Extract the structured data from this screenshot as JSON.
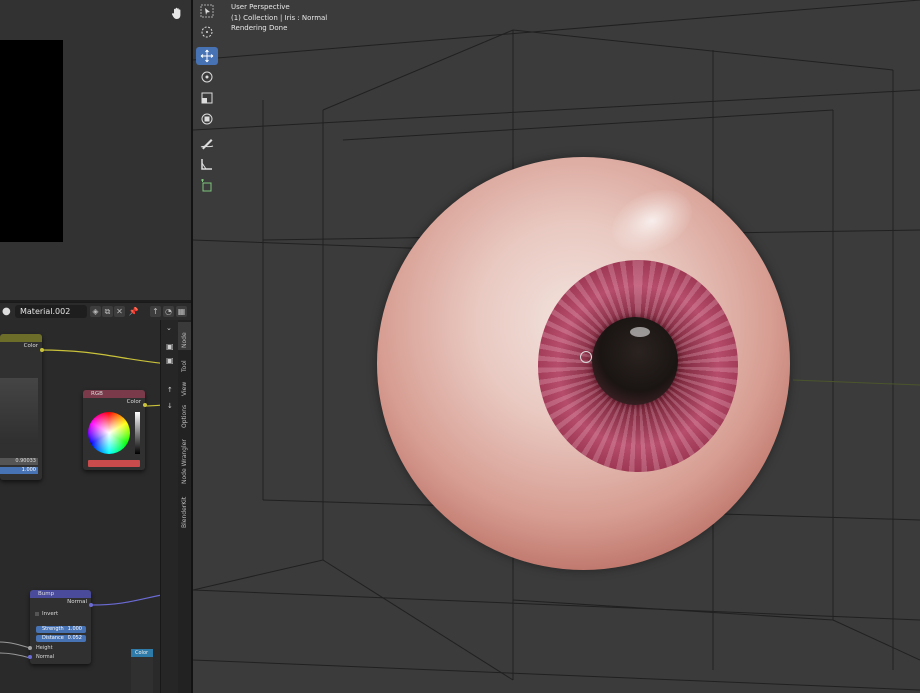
{
  "viewport": {
    "overlay": {
      "perspective": "User Perspective",
      "collection": "(1) Collection | Iris : Normal",
      "status": "Rendering Done"
    },
    "tools": [
      "select-box",
      "cursor",
      "move",
      "rotate",
      "scale",
      "transform",
      "annotate",
      "measure",
      "add-cube"
    ],
    "active_tool": "move"
  },
  "node_editor": {
    "material_name": "Material.002",
    "sidebar_tabs": [
      "Node",
      "Tool",
      "View",
      "Options",
      "Node Wrangler",
      "BlenderKit"
    ],
    "active_tab": "Node",
    "curves_node": {
      "output": "Color",
      "field_value": "0.90033",
      "field_value2": "1.000"
    },
    "rgb_node": {
      "title": "RGB",
      "output": "Color",
      "color": "#c94b4b"
    },
    "bump_node": {
      "title": "Bump",
      "output": "Normal",
      "invert_label": "Invert",
      "strength_label": "Strength",
      "strength_value": "1.000",
      "distance_label": "Distance",
      "distance_value": "0.052",
      "height_label": "Height",
      "normal_label": "Normal"
    },
    "right_node_title": "Color"
  },
  "colors": {
    "accent": "#4772b3",
    "viewport_bg": "#3b3b3b",
    "wire_yellow": "#c9c23a",
    "wire_purple": "#6b6bd6"
  }
}
